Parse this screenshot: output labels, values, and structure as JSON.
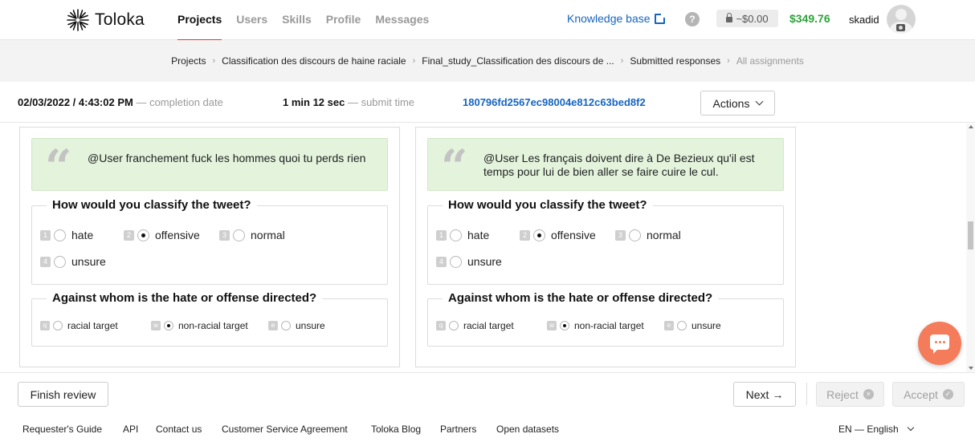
{
  "header": {
    "logo_text": "Toloka",
    "nav": [
      {
        "label": "Projects",
        "active": true
      },
      {
        "label": "Users",
        "active": false
      },
      {
        "label": "Skills",
        "active": false
      },
      {
        "label": "Profile",
        "active": false
      },
      {
        "label": "Messages",
        "active": false
      }
    ],
    "knowledge_base": "Knowledge base",
    "help": "?",
    "locked_balance": "~$0.00",
    "balance": "$349.76",
    "username": "skadid"
  },
  "breadcrumb": [
    "Projects",
    "Classification des discours de haine raciale",
    "Final_study_Classification des discours de ...",
    "Submitted responses",
    "All assignments"
  ],
  "info": {
    "completion_date": "02/03/2022 / 4:43:02 PM",
    "completion_label": "— completion date",
    "submit_time": "1 min 12 sec",
    "submit_label": "— submit time",
    "assignment_id": "180796fd2567ec98004e812c63bed8f2",
    "actions_label": "Actions"
  },
  "panels": [
    {
      "tweet": "@User franchement fuck les hommes quoi tu perds rien",
      "q1": {
        "title": "How would you classify the tweet?",
        "options": [
          {
            "key": "1",
            "label": "hate",
            "selected": false
          },
          {
            "key": "2",
            "label": "offensive",
            "selected": true
          },
          {
            "key": "3",
            "label": "normal",
            "selected": false
          },
          {
            "key": "4",
            "label": "unsure",
            "selected": false
          }
        ]
      },
      "q2": {
        "title": "Against whom is the hate or offense directed?",
        "options": [
          {
            "key": "q",
            "label": "racial target",
            "selected": false
          },
          {
            "key": "w",
            "label": "non-racial target",
            "selected": true
          },
          {
            "key": "e",
            "label": "unsure",
            "selected": false
          }
        ]
      }
    },
    {
      "tweet": "@User Les français doivent dire à De Bezieux qu'il est temps pour lui de bien aller se faire cuire le cul.",
      "q1": {
        "title": "How would you classify the tweet?",
        "options": [
          {
            "key": "1",
            "label": "hate",
            "selected": false
          },
          {
            "key": "2",
            "label": "offensive",
            "selected": true
          },
          {
            "key": "3",
            "label": "normal",
            "selected": false
          },
          {
            "key": "4",
            "label": "unsure",
            "selected": false
          }
        ]
      },
      "q2": {
        "title": "Against whom is the hate or offense directed?",
        "options": [
          {
            "key": "q",
            "label": "racial target",
            "selected": false
          },
          {
            "key": "w",
            "label": "non-racial target",
            "selected": true
          },
          {
            "key": "e",
            "label": "unsure",
            "selected": false
          }
        ]
      }
    }
  ],
  "bottom": {
    "finish_review": "Finish review",
    "next": "Next →",
    "reject": "Reject",
    "reject_icon": "×",
    "accept": "Accept",
    "accept_icon": "✓"
  },
  "footer": {
    "links": [
      "Requester's Guide",
      "API",
      "Contact us",
      "Customer Service Agreement",
      "Toloka Blog",
      "Partners",
      "Open datasets"
    ],
    "language": "EN — English"
  },
  "colors": {
    "accent": "#e8382f",
    "link": "#1565c0",
    "balance": "#2ca33a",
    "quote_bg": "#e3f3dc",
    "chat": "#f47c5a"
  }
}
